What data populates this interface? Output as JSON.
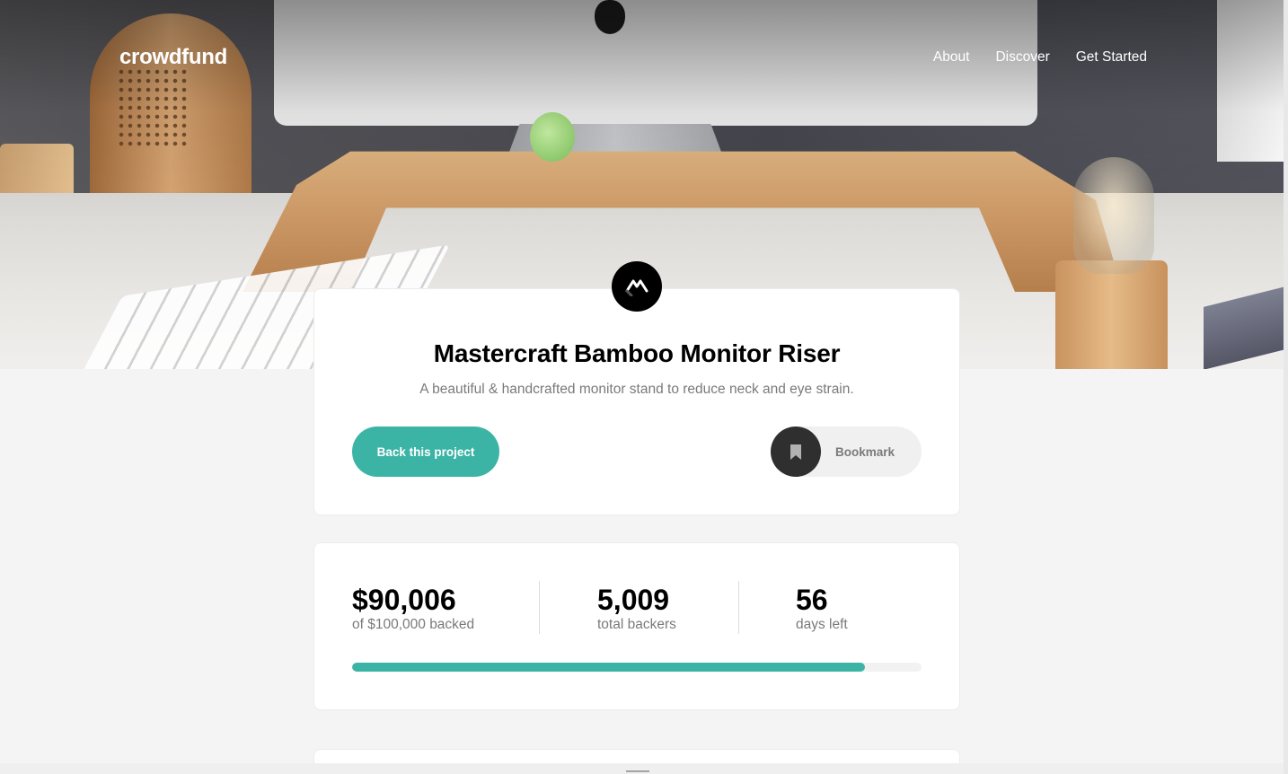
{
  "header": {
    "logo": "crowdfund",
    "nav": [
      "About",
      "Discover",
      "Get Started"
    ]
  },
  "project": {
    "title": "Mastercraft Bamboo Monitor Riser",
    "description": "A beautiful & handcrafted monitor stand to reduce neck and eye strain.",
    "back_button": "Back this project",
    "bookmark_label": "Bookmark",
    "logo_icon": "mastercraft-logo-icon",
    "bookmark_icon": "bookmark-icon"
  },
  "stats": {
    "backed": {
      "value": "$90,006",
      "label": "of $100,000 backed"
    },
    "backers": {
      "value": "5,009",
      "label": "total backers"
    },
    "days": {
      "value": "56",
      "label": "days left"
    },
    "progress_fraction": 0.90006
  },
  "colors": {
    "accent": "#3cb4a5",
    "dark": "#2f2f2f",
    "muted_text": "#7a7a7a"
  }
}
